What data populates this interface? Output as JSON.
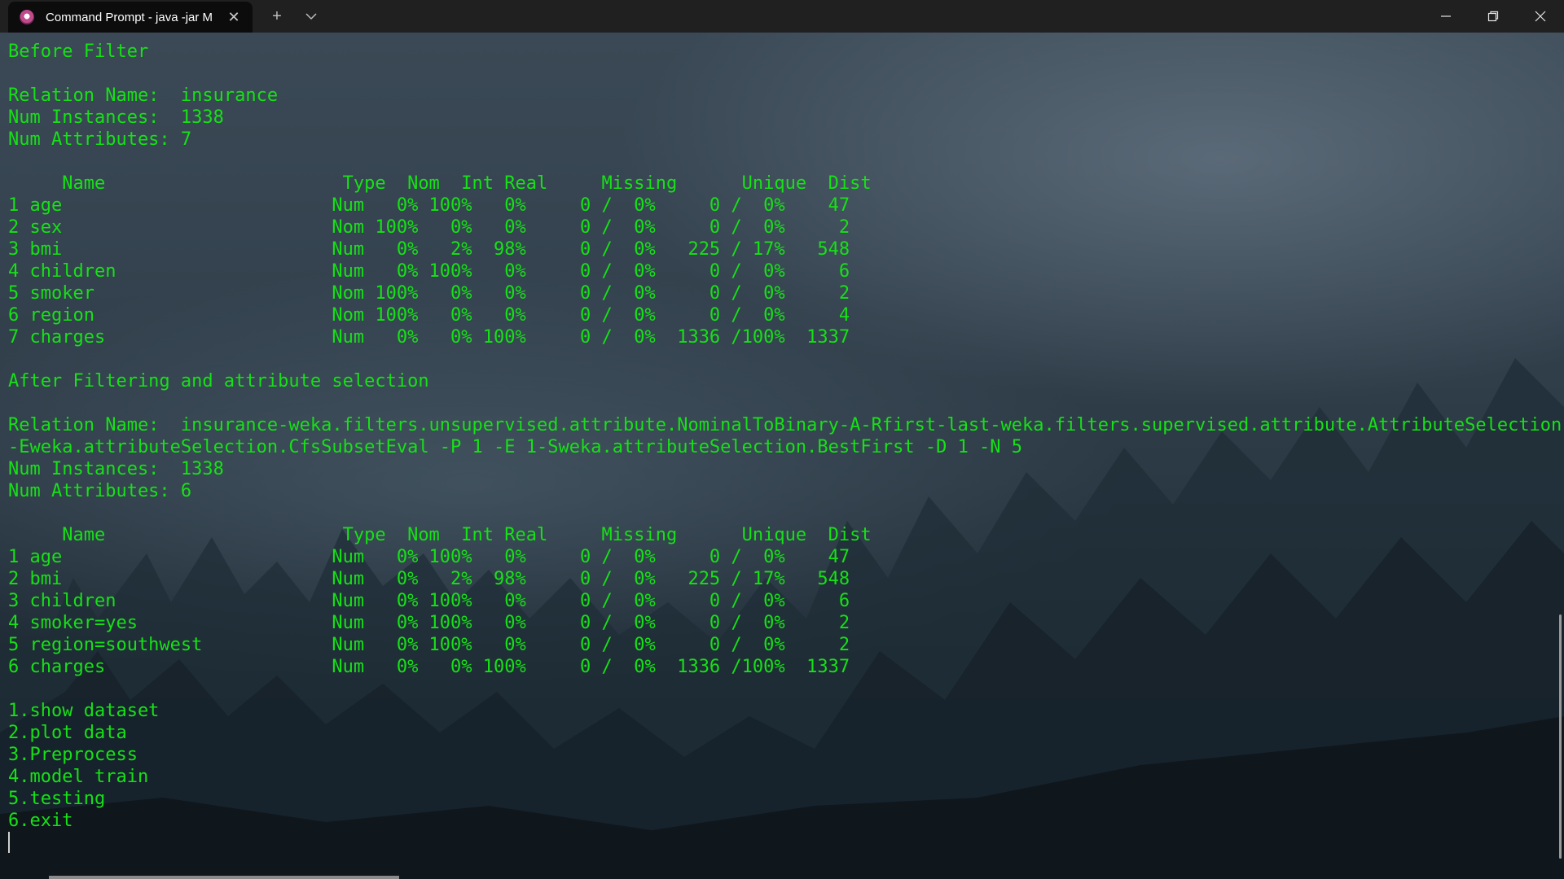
{
  "window": {
    "tab_title": "Command Prompt - java  -jar M",
    "tab_icon": "terminal-app-icon",
    "new_tab_label": "+",
    "dropdown_icon": "chevron-down-icon",
    "controls": [
      "minimize-icon",
      "restore-icon",
      "close-icon"
    ]
  },
  "terminal": {
    "lines": [
      "Before Filter",
      "",
      "Relation Name:  insurance",
      "Num Instances:  1338",
      "Num Attributes: 7",
      "",
      "     Name                      Type  Nom  Int Real     Missing      Unique  Dist",
      "1 age                         Num   0% 100%   0%     0 /  0%     0 /  0%    47",
      "2 sex                         Nom 100%   0%   0%     0 /  0%     0 /  0%     2",
      "3 bmi                         Num   0%   2%  98%     0 /  0%   225 / 17%   548",
      "4 children                    Num   0% 100%   0%     0 /  0%     0 /  0%     6",
      "5 smoker                      Nom 100%   0%   0%     0 /  0%     0 /  0%     2",
      "6 region                      Nom 100%   0%   0%     0 /  0%     0 /  0%     4",
      "7 charges                     Num   0%   0% 100%     0 /  0%  1336 /100%  1337",
      "",
      "After Filtering and attribute selection",
      "",
      "Relation Name:  insurance-weka.filters.unsupervised.attribute.NominalToBinary-A-Rfirst-last-weka.filters.supervised.attribute.AttributeSelection",
      "-Eweka.attributeSelection.CfsSubsetEval -P 1 -E 1-Sweka.attributeSelection.BestFirst -D 1 -N 5",
      "Num Instances:  1338",
      "Num Attributes: 6",
      "",
      "     Name                      Type  Nom  Int Real     Missing      Unique  Dist",
      "1 age                         Num   0% 100%   0%     0 /  0%     0 /  0%    47",
      "2 bmi                         Num   0%   2%  98%     0 /  0%   225 / 17%   548",
      "3 children                    Num   0% 100%   0%     0 /  0%     0 /  0%     6",
      "4 smoker=yes                  Num   0% 100%   0%     0 /  0%     0 /  0%     2",
      "5 region=southwest            Num   0% 100%   0%     0 /  0%     0 /  0%     2",
      "6 charges                     Num   0%   0% 100%     0 /  0%  1336 /100%  1337",
      "",
      "1.show dataset",
      "2.plot data",
      "3.Preprocess",
      "4.model train",
      "5.testing",
      "6.exit"
    ]
  },
  "colors": {
    "terminal_text": "#16e116",
    "titlebar": "#202020",
    "tab": "#0c0c0c"
  }
}
